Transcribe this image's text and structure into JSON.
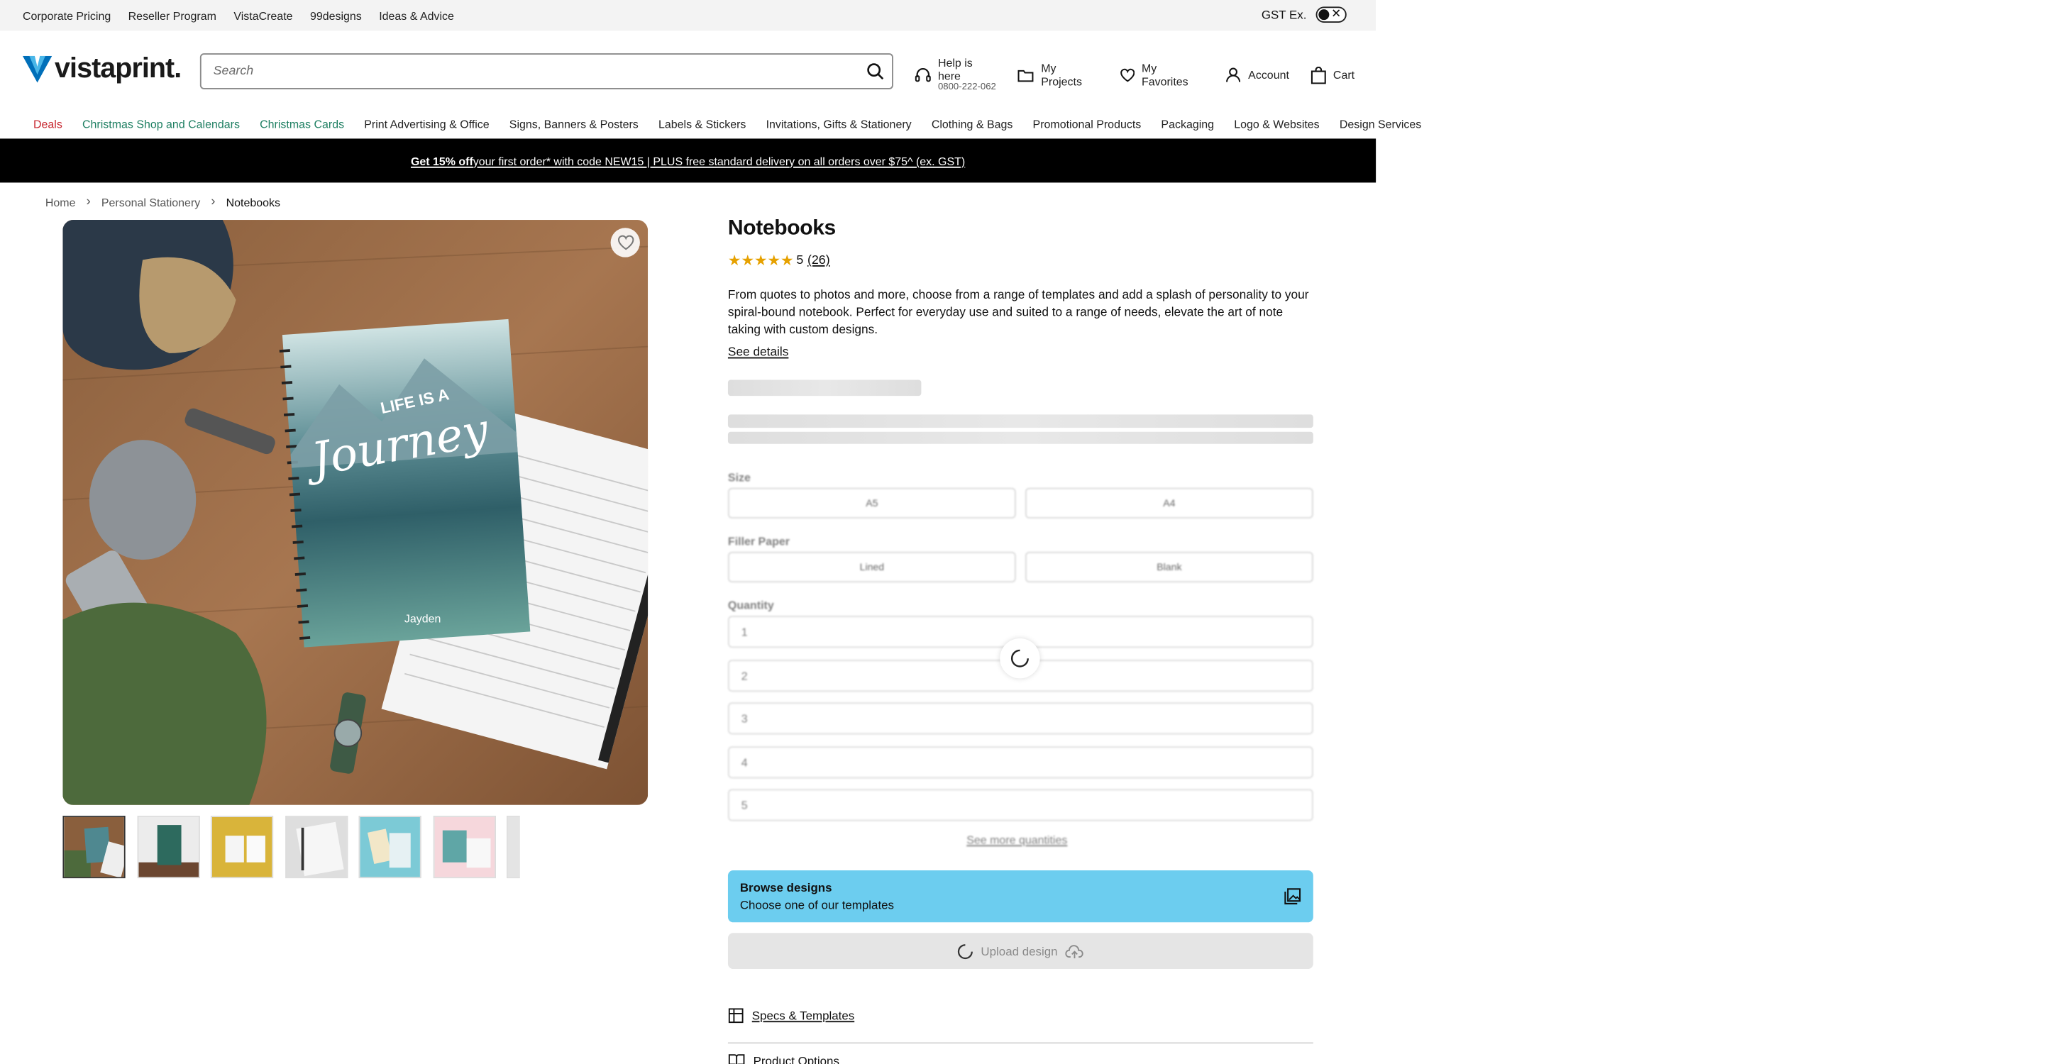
{
  "topbar": {
    "links": [
      "Corporate Pricing",
      "Reseller Program",
      "VistaCreate",
      "99designs",
      "Ideas & Advice"
    ],
    "gst_label": "GST Ex."
  },
  "header": {
    "logo_text": "vistaprint.",
    "search_placeholder": "Search",
    "help_title": "Help is here",
    "help_phone": "0800-222-062",
    "my_projects": "My Projects",
    "my_favorites": "My Favorites",
    "account": "Account",
    "cart": "Cart"
  },
  "nav": {
    "items": [
      {
        "label": "Deals",
        "color": "#c7262e"
      },
      {
        "label": "Christmas Shop and Calendars",
        "color": "#1e7f62"
      },
      {
        "label": "Christmas Cards",
        "color": "#1e7f62"
      },
      {
        "label": "Print Advertising & Office"
      },
      {
        "label": "Signs, Banners & Posters"
      },
      {
        "label": "Labels & Stickers"
      },
      {
        "label": "Invitations, Gifts & Stationery"
      },
      {
        "label": "Clothing & Bags"
      },
      {
        "label": "Promotional Products"
      },
      {
        "label": "Packaging"
      },
      {
        "label": "Logo & Websites"
      },
      {
        "label": "Design Services"
      }
    ]
  },
  "promo": {
    "bold": "Get 15% off",
    "rest": " your first order* with code NEW15 |   PLUS free standard delivery on all orders over $75^ (ex. GST)"
  },
  "breadcrumb": {
    "home": "Home",
    "category": "Personal Stationery",
    "current": "Notebooks"
  },
  "image": {
    "notebook_title_top": "LIFE IS A",
    "notebook_title_script": "Journey",
    "notebook_name": "Jayden"
  },
  "product": {
    "title": "Notebooks",
    "rating": "5",
    "reviews": "(26)",
    "description": "From quotes to photos and more, choose from a range of templates and add a splash of personality to your spiral-bound notebook. Perfect for everyday use and suited to a range of needs, elevate the art of note taking with custom designs.",
    "see_details": "See details"
  },
  "options": {
    "size_label": "Size",
    "sizes": [
      "A5",
      "A4"
    ],
    "filler_label": "Filler Paper",
    "fillers": [
      "Lined",
      "Blank"
    ],
    "quantity_label": "Quantity",
    "quantities": [
      "1",
      "2",
      "3",
      "4",
      "5"
    ],
    "see_more": "See more quantities"
  },
  "actions": {
    "browse_title": "Browse designs",
    "browse_sub": "Choose one of our templates",
    "upload": "Upload design",
    "specs": "Specs & Templates",
    "product_options": "Product Options"
  },
  "colors": {
    "deal_red": "#c7262e",
    "holiday_green": "#1e7f62",
    "browse_blue": "#6ccdef",
    "logo_blue": "#006fb9"
  }
}
